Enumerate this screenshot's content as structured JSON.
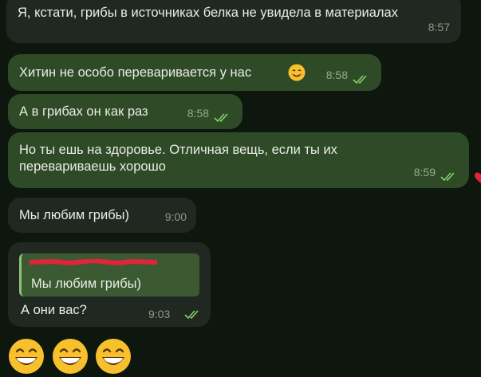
{
  "messages": [
    {
      "text": "Я, кстати, грибы в источниках белка не увидела в материалах",
      "time": "8:57"
    },
    {
      "text": "Хитин не особо переваривается у нас",
      "time": "8:58"
    },
    {
      "text": "А в грибах он как раз",
      "time": "8:58"
    },
    {
      "text": "Но ты ешь на здоровье. Отличная вещь, если ты их перевариваешь хорошо",
      "time": "8:59"
    },
    {
      "text": "Мы любим грибы)",
      "time": "9:00"
    },
    {
      "reply_quote": "Мы любим грибы)",
      "text": "А они вас?",
      "time": "9:03"
    }
  ],
  "icons": {
    "read_receipt": "double-check-icon",
    "smile": "smiling-face-icon",
    "grin": "grinning-face-icon",
    "reaction": "heart-icon"
  },
  "colors": {
    "background": "#0d170d",
    "incoming_bubble": "#212822",
    "outgoing_bubble": "#2f4a27",
    "check": "#7fd46a"
  }
}
